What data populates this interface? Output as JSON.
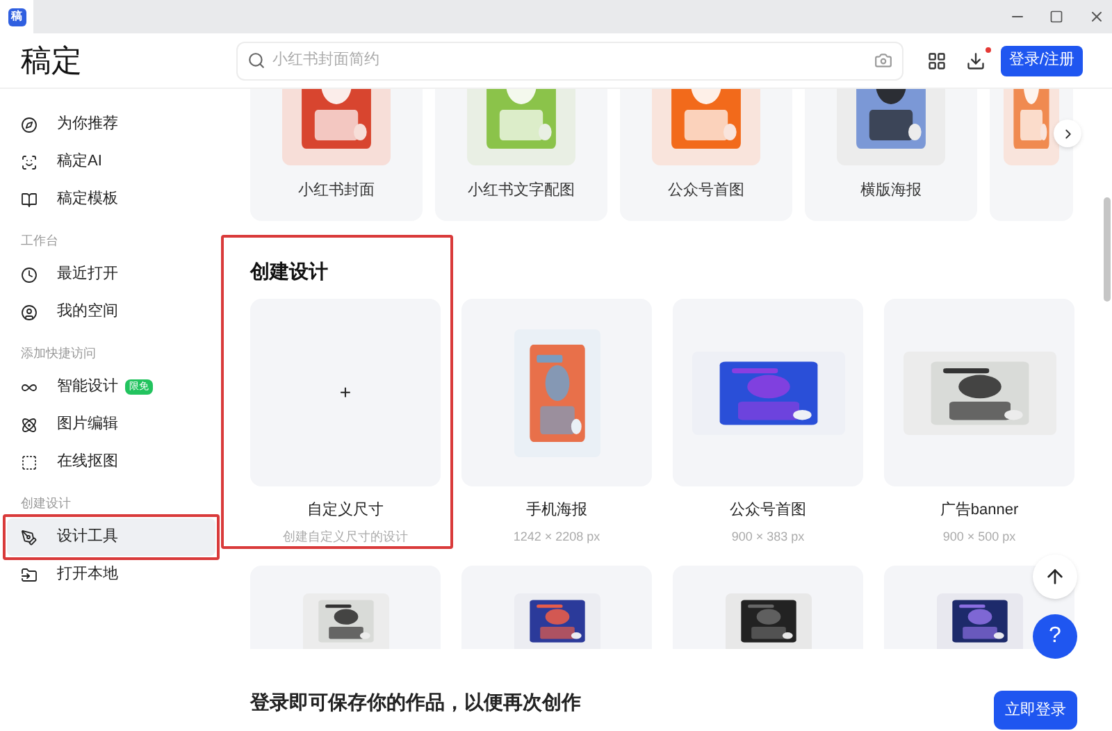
{
  "app": {
    "logo_glyph": "稿",
    "name": "稿定"
  },
  "search": {
    "placeholder": "小红书封面简约"
  },
  "header": {
    "login_button": "登录/注册",
    "download_badge": true
  },
  "sidebar": {
    "groups": [
      {
        "items": [
          {
            "label": "为你推荐",
            "selected": false
          },
          {
            "label": "稿定AI",
            "selected": false
          },
          {
            "label": "稿定模板",
            "selected": false
          }
        ]
      },
      {
        "title": "工作台",
        "items": [
          {
            "label": "最近打开",
            "selected": false
          },
          {
            "label": "我的空间",
            "selected": false
          }
        ]
      },
      {
        "title": "添加快捷访问",
        "items": [
          {
            "label": "智能设计",
            "badge": "限免",
            "selected": false
          },
          {
            "label": "图片编辑",
            "selected": false
          },
          {
            "label": "在线抠图",
            "selected": false
          }
        ]
      },
      {
        "title": "创建设计",
        "items": [
          {
            "label": "设计工具",
            "selected": true,
            "highlighted": true
          },
          {
            "label": "打开本地",
            "selected": false
          }
        ]
      }
    ]
  },
  "carousel": [
    {
      "label": "小红书封面"
    },
    {
      "label": "小红书文字配图"
    },
    {
      "label": "公众号首图"
    },
    {
      "label": "横版海报"
    },
    {
      "kind": "picture"
    }
  ],
  "create_design": {
    "title": "创建设计",
    "highlighted": true,
    "cards": [
      {
        "kind": "custom",
        "icon": "+",
        "label": "自定义尺寸",
        "size": "创建自定义尺寸的设计"
      },
      {
        "kind": "template",
        "label": "手机海报",
        "size": "1242 × 2208 px"
      },
      {
        "kind": "template",
        "label": "公众号首图",
        "size": "900 × 383 px"
      },
      {
        "kind": "template",
        "label": "广告banner",
        "size": "900 × 500 px"
      }
    ]
  },
  "more_templates": [
    {
      "kind": "picture"
    },
    {
      "kind": "picture"
    },
    {
      "kind": "picture"
    },
    {
      "kind": "picture"
    }
  ],
  "login_banner": {
    "text": "登录即可保存你的作品，以便再次创作",
    "button": "立即登录"
  },
  "help_button": {
    "icon": "?"
  }
}
